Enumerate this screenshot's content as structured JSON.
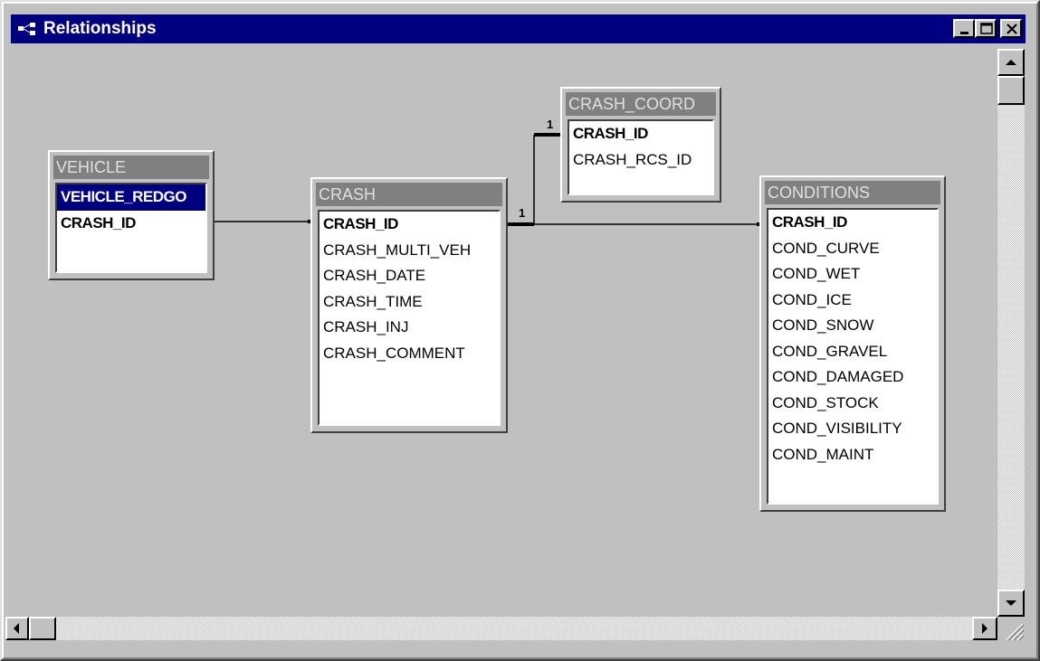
{
  "window": {
    "title": "Relationships"
  },
  "tables": {
    "vehicle": {
      "name": "VEHICLE",
      "fields": [
        "VEHICLE_REDGO",
        "CRASH_ID"
      ]
    },
    "crash": {
      "name": "CRASH",
      "fields": [
        "CRASH_ID",
        "CRASH_MULTI_VEH",
        "CRASH_DATE",
        "CRASH_TIME",
        "CRASH_INJ",
        "CRASH_COMMENT"
      ]
    },
    "crash_coord": {
      "name": "CRASH_COORD",
      "fields": [
        "CRASH_ID",
        "CRASH_RCS_ID"
      ]
    },
    "conditions": {
      "name": "CONDITIONS",
      "fields": [
        "CRASH_ID",
        "COND_CURVE",
        "COND_WET",
        "COND_ICE",
        "COND_SNOW",
        "COND_GRAVEL",
        "COND_DAMAGED",
        "COND_STOCK",
        "COND_VISIBILITY",
        "COND_MAINT"
      ]
    }
  },
  "relationships": {
    "crash_to_coord_label": "1",
    "crash_to_conditions_label": "1"
  },
  "icons": {
    "window_icon": "relationships-icon",
    "minimize": "minimize-icon",
    "maximize": "maximize-icon",
    "close": "close-icon"
  },
  "colors": {
    "titlebar": "#000080",
    "face": "#c0c0c0",
    "table_header": "#808080",
    "selection": "#000080"
  }
}
